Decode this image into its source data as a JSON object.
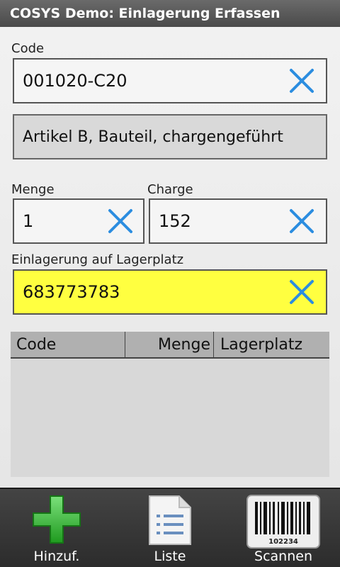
{
  "title": "COSYS Demo: Einlagerung Erfassen",
  "code": {
    "label": "Code",
    "value": "001020-C20"
  },
  "article": {
    "value": "Artikel B, Bauteil, chargengeführt"
  },
  "menge": {
    "label": "Menge",
    "value": "1"
  },
  "charge": {
    "label": "Charge",
    "value": "152"
  },
  "lagerplatz": {
    "label": "Einlagerung auf Lagerplatz",
    "value": "683773783",
    "highlight": "#ffff40"
  },
  "table": {
    "columns": [
      "Code",
      "Menge",
      "Lagerplatz"
    ],
    "rows": []
  },
  "bottom": {
    "add_label": "Hinzuf.",
    "list_label": "Liste",
    "scan_label": "Scannen",
    "barcode_number": "102234"
  },
  "colors": {
    "accent": "#2b8de0",
    "add": "#3cc83c"
  }
}
